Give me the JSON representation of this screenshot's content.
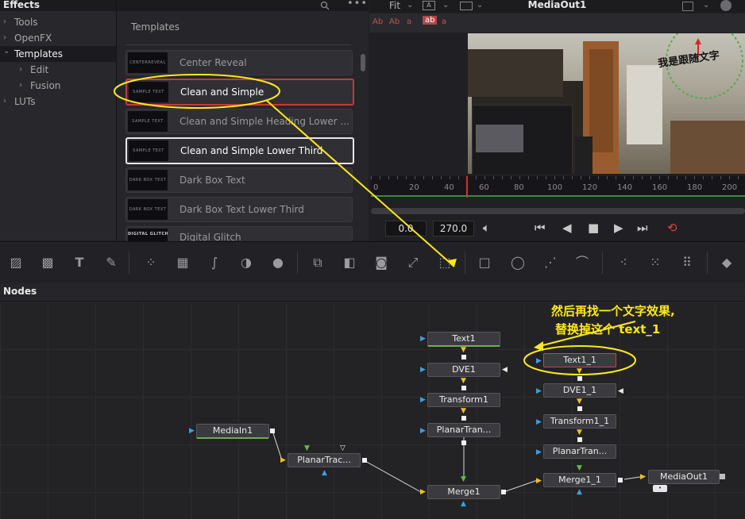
{
  "effects": {
    "title": "Effects",
    "tree": [
      {
        "label": "Tools",
        "chev": "›"
      },
      {
        "label": "OpenFX",
        "chev": "›"
      },
      {
        "label": "Templates",
        "chev": "⌄"
      },
      {
        "label": "Edit",
        "chev": "›"
      },
      {
        "label": "Fusion",
        "chev": "›"
      },
      {
        "label": "LUTs",
        "chev": "›"
      }
    ]
  },
  "templates": {
    "title": "Templates",
    "items": [
      {
        "name": "Center Reveal",
        "thumb": "CENTERREVEAL"
      },
      {
        "name": "Clean and Simple",
        "thumb": "SAMPLE TEXT"
      },
      {
        "name": "Clean and Simple Heading Lower ...",
        "thumb": "SAMPLE TEXT"
      },
      {
        "name": "Clean and Simple Lower Third",
        "thumb": "SAMPLE TEXT"
      },
      {
        "name": "Dark Box Text",
        "thumb": "DARK BOX TEXT"
      },
      {
        "name": "Dark Box Text Lower Third",
        "thumb": "DARK BOX TEXT"
      },
      {
        "name": "Digital Glitch",
        "thumb": "DIGITAL GLITCH"
      }
    ]
  },
  "viewer": {
    "fit": "Fit",
    "title": "MediaOut1",
    "overlay_text": "我是跟随文字",
    "ruler": [
      "0",
      "20",
      "40",
      "60",
      "80",
      "100",
      "120",
      "140",
      "160",
      "180",
      "200"
    ],
    "time_start": "0.0",
    "time_end": "270.0"
  },
  "nodes": {
    "title": "Nodes",
    "list": {
      "text1": "Text1",
      "dve1": "DVE1",
      "transform1": "Transform1",
      "planar1": "PlanarTran...",
      "merge1": "Merge1",
      "mediain1": "MediaIn1",
      "planartrac": "PlanarTrac...",
      "text1_1": "Text1_1",
      "dve1_1": "DVE1_1",
      "transform1_1": "Transform1_1",
      "planar1_1": "PlanarTran...",
      "merge1_1": "Merge1_1",
      "mediaout1": "MediaOut1"
    }
  },
  "annotation": {
    "line1": "然后再找一个文字效果,",
    "line2": "替换掉这个 text_1"
  },
  "colors": {
    "accent_red": "#c43a3a",
    "annotation": "#ffe81a"
  }
}
